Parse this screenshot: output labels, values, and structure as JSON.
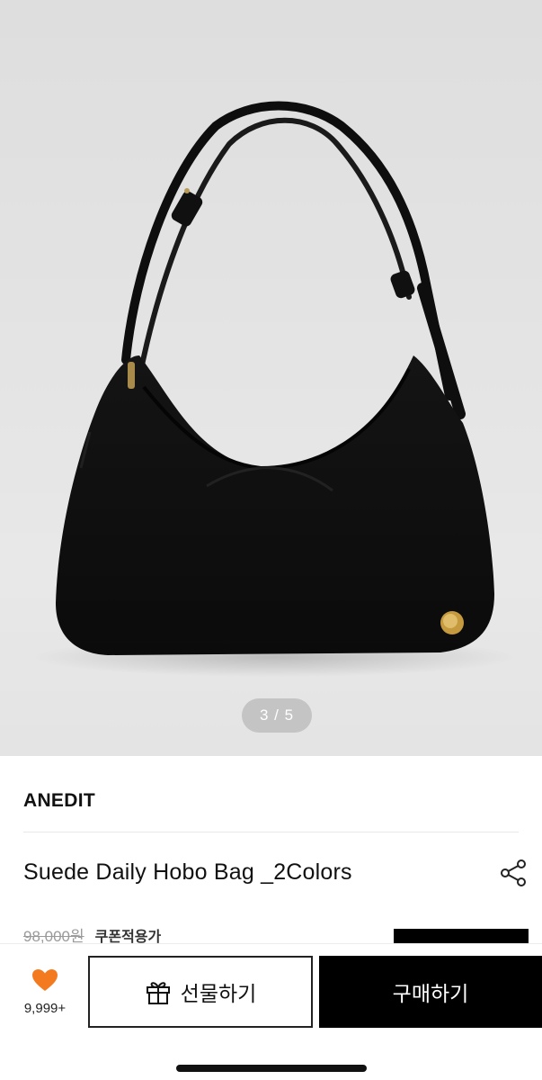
{
  "gallery": {
    "image_alt": "hobo-bag-photo",
    "pager": "3 / 5"
  },
  "product": {
    "brand": "ANEDIT",
    "title": "Suede Daily Hobo Bag _2Colors",
    "original_price": "98,000원",
    "coupon_label": "쿠폰적용가"
  },
  "actions": {
    "like_count": "9,999+",
    "gift_label": "선물하기",
    "buy_label": "구매하기"
  },
  "icons": {
    "like": "heart-icon",
    "gift": "gift-icon",
    "share": "share-icon"
  },
  "colors": {
    "heart": "#f47a20",
    "buy_button": "#000000"
  }
}
